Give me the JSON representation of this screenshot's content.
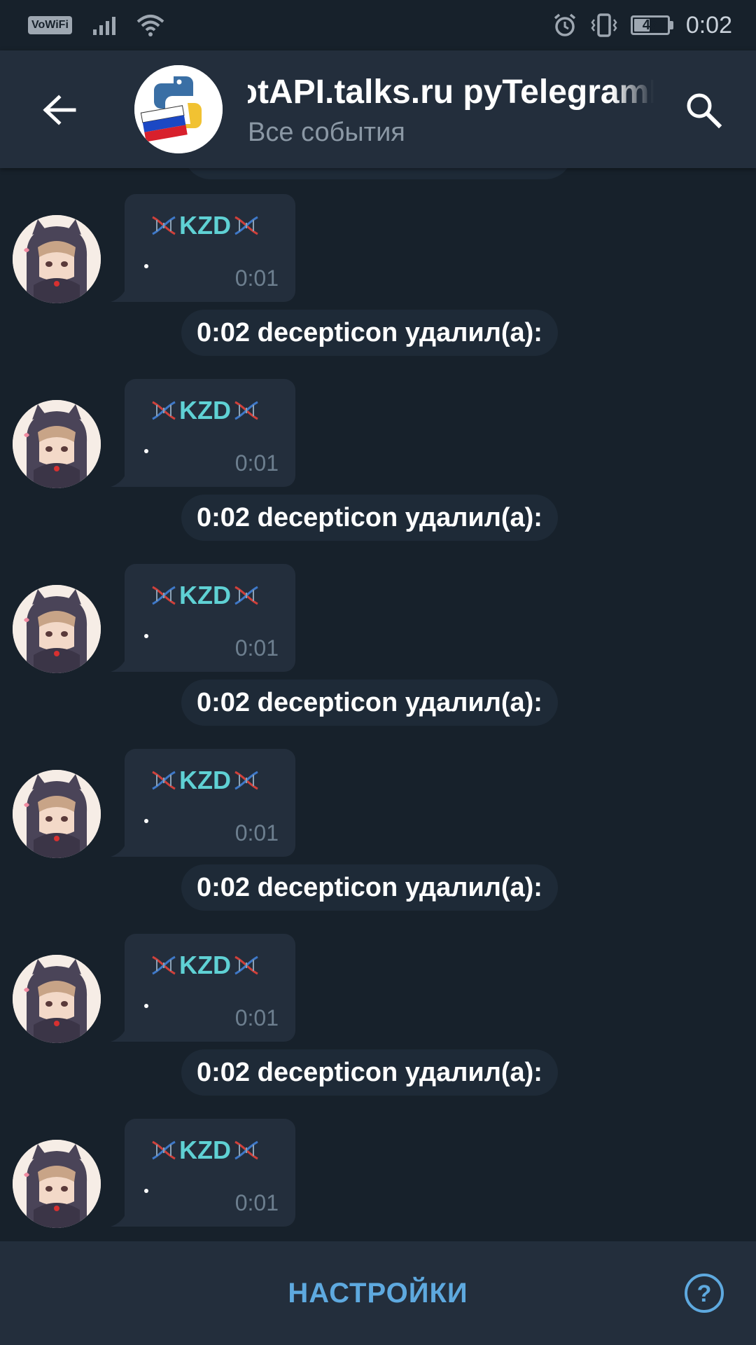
{
  "status_bar": {
    "vowifi": "VoWiFi",
    "battery": "47",
    "battery_level": 0.47,
    "time": "0:02",
    "icons": [
      "signal-icon",
      "wifi-icon",
      "alarm-icon",
      "vibrate-icon",
      "battery-icon"
    ]
  },
  "header": {
    "title": "BotAPI.talks.ru    pyTelegramBotAPI",
    "subtitle": "Все события",
    "back_icon": "back-arrow-icon",
    "search_icon": "search-icon"
  },
  "messages": [
    {
      "sender": "KZD",
      "text": ".",
      "time": "0:01",
      "action": "0:02 decepticon удалил(а):"
    },
    {
      "sender": "KZD",
      "text": ".",
      "time": "0:01",
      "action": "0:02 decepticon удалил(а):"
    },
    {
      "sender": "KZD",
      "text": ".",
      "time": "0:01",
      "action": "0:02 decepticon удалил(а):"
    },
    {
      "sender": "KZD",
      "text": ".",
      "time": "0:01",
      "action": "0:02 decepticon удалил(а):"
    },
    {
      "sender": "KZD",
      "text": ".",
      "time": "0:01",
      "action": "0:02 decepticon удалил(а):"
    },
    {
      "sender": "KZD",
      "text": ".",
      "time": "0:01"
    }
  ],
  "bottom_bar": {
    "settings_label": "НАСТРОЙКИ",
    "help_icon": "help-icon"
  },
  "colors": {
    "background": "#17212b",
    "panel": "#232e3c",
    "sender_name": "#5fd1d4",
    "accent": "#5ea9df",
    "muted": "#6d7f8f"
  }
}
